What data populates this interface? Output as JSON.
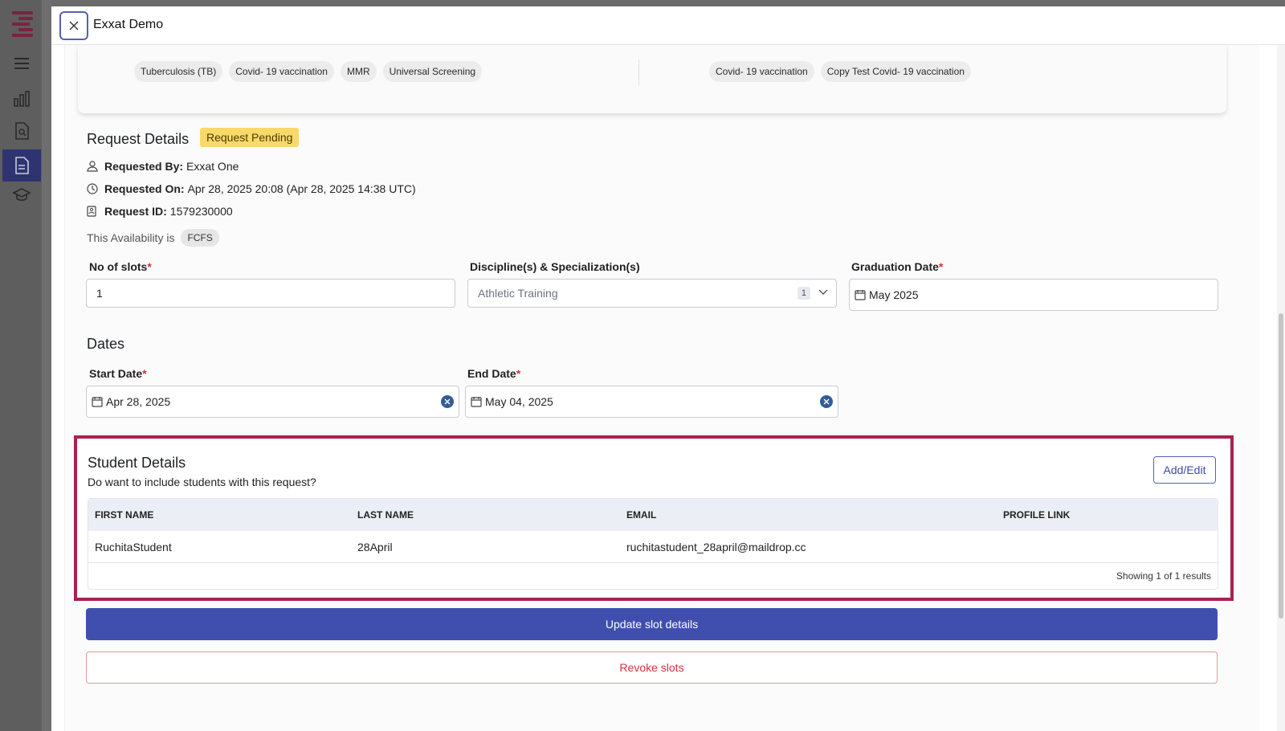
{
  "header": {
    "title": "Exxat Demo",
    "close_icon": "close-icon"
  },
  "top_card": {
    "left_chips": [
      "Tuberculosis (TB)",
      "Covid- 19 vaccination",
      "MMR",
      "Universal Screening"
    ],
    "right_chips": [
      "Covid- 19 vaccination",
      "Copy Test Covid- 19 vaccination"
    ]
  },
  "request": {
    "title": "Request Details",
    "status": "Request Pending",
    "requested_by_label": "Requested By:",
    "requested_by": "Exxat One",
    "requested_on_label": "Requested On:",
    "requested_on": "Apr 28, 2025 20:08 (Apr 28, 2025 14:38 UTC)",
    "request_id_label": "Request ID:",
    "request_id": "1579230000",
    "availability_text": "This Availability is",
    "availability_value": "FCFS"
  },
  "fields": {
    "slots_label": "No of slots",
    "slots_value": "1",
    "discipline_label": "Discipline(s) & Specialization(s)",
    "discipline_value": "Athletic Training",
    "discipline_count": "1",
    "graduation_label": "Graduation Date",
    "graduation_value": "May 2025",
    "required_mark": "*"
  },
  "dates": {
    "title": "Dates",
    "start_label": "Start Date",
    "start_value": "Apr 28, 2025",
    "end_label": "End Date",
    "end_value": "May 04, 2025"
  },
  "students": {
    "title": "Student Details",
    "subtitle": "Do want to include students with this request?",
    "add_edit_label": "Add/Edit",
    "columns": [
      "FIRST NAME",
      "LAST NAME",
      "EMAIL",
      "PROFILE LINK"
    ],
    "rows": [
      {
        "first": "RuchitaStudent",
        "last": "28April",
        "email": "ruchitastudent_28april@maildrop.cc",
        "profile": ""
      }
    ],
    "footer": "Showing 1 of 1 results"
  },
  "actions": {
    "update_label": "Update slot details",
    "revoke_label": "Revoke slots"
  },
  "colors": {
    "primary": "#404fae",
    "highlight_border": "#a8224f",
    "status_badge": "#f8d96a",
    "danger": "#d9303c"
  }
}
